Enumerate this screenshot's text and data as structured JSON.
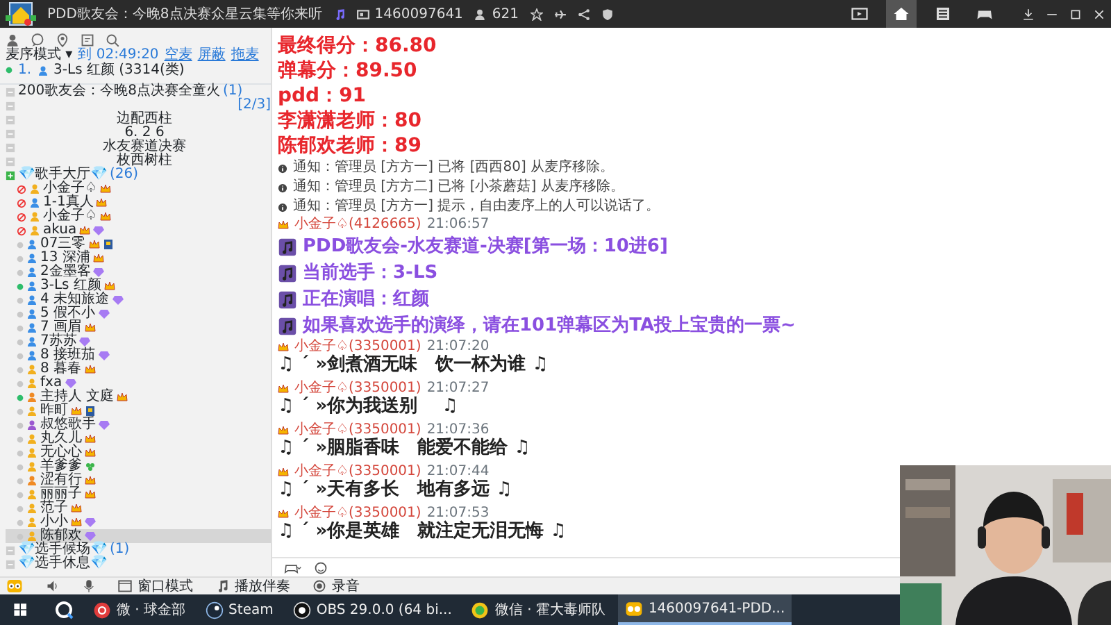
{
  "top_bar": {
    "title": "PDD歌友会：今晚8点决赛众星云集等你来听",
    "channel_id": "1460097641",
    "online_count": "621",
    "nav_tabs": [
      {
        "kind": "video",
        "selected": false
      },
      {
        "kind": "home",
        "selected": true
      },
      {
        "kind": "list",
        "selected": false
      },
      {
        "kind": "game",
        "selected": false
      }
    ]
  },
  "sidebar": {
    "mode": "麦序模式 ▾",
    "timer": "到 02:49:20",
    "actions": [
      "空麦",
      "屏蔽",
      "拖麦"
    ],
    "queue": [
      {
        "index": "1.",
        "name": "3-Ls 红颜 (3314(类)",
        "on_mic": true
      }
    ],
    "tree": [
      {
        "kind": "channel",
        "text": "200歌友会：今晚8点决赛全童火",
        "count": "(1)",
        "expanded": false
      },
      {
        "kind": "channel",
        "count": "[2/3]",
        "expanded": false
      },
      {
        "kind": "banner",
        "text": "边配西柱",
        "expanded": false
      },
      {
        "kind": "banner",
        "text": "6. 2 6",
        "expanded": false
      },
      {
        "kind": "banner",
        "text": "水友赛道决赛",
        "expanded": false
      },
      {
        "kind": "banner",
        "text": "枚西树柱",
        "expanded": false
      },
      {
        "kind": "channel",
        "text": "💎歌手大厅💎",
        "count": "(26)",
        "expanded": true,
        "children": [
          {
            "name": "小金子♤",
            "muted": true,
            "speaking": false,
            "color": "#f2b01e",
            "badges": [
              {
                "kind": "crown"
              }
            ],
            "selected": false
          },
          {
            "name": "1-1真人",
            "muted": true,
            "speaking": false,
            "color": "#3a8ee6",
            "badges": [
              {
                "kind": "crown"
              }
            ],
            "selected": false
          },
          {
            "name": "小金子♤",
            "muted": true,
            "speaking": false,
            "color": "#f2b01e",
            "badges": [
              {
                "kind": "crown"
              }
            ],
            "selected": false
          },
          {
            "name": "akua",
            "muted": true,
            "speaking": false,
            "color": "#f2b01e",
            "badges": [
              {
                "kind": "crown"
              },
              {
                "kind": "gem"
              }
            ],
            "selected": false
          },
          {
            "name": "07三零",
            "muted": false,
            "speaking": false,
            "color": "#3a8ee6",
            "badges": [
              {
                "kind": "crown"
              },
              {
                "kind": "card"
              }
            ],
            "selected": false
          },
          {
            "name": "13 深浦",
            "muted": false,
            "speaking": false,
            "color": "#3a8ee6",
            "badges": [
              {
                "kind": "crown"
              }
            ],
            "selected": false
          },
          {
            "name": "2金墨客",
            "muted": false,
            "speaking": false,
            "color": "#3a8ee6",
            "badges": [
              {
                "kind": "gem"
              }
            ],
            "selected": false
          },
          {
            "name": "3-Ls 红颜",
            "muted": false,
            "speaking": true,
            "color": "#3a8ee6",
            "badges": [
              {
                "kind": "crown"
              }
            ],
            "selected": false
          },
          {
            "name": "4 未知旅途",
            "muted": false,
            "speaking": false,
            "color": "#3a8ee6",
            "badges": [
              {
                "kind": "gem"
              }
            ],
            "selected": false
          },
          {
            "name": "5 假不小",
            "muted": false,
            "speaking": false,
            "color": "#3a8ee6",
            "badges": [
              {
                "kind": "gem"
              }
            ],
            "selected": false
          },
          {
            "name": "7 画眉",
            "muted": false,
            "speaking": false,
            "color": "#3a8ee6",
            "badges": [
              {
                "kind": "crown"
              }
            ],
            "selected": false
          },
          {
            "name": "7苏苏",
            "muted": false,
            "speaking": false,
            "color": "#3a8ee6",
            "badges": [
              {
                "kind": "gem"
              }
            ],
            "selected": false
          },
          {
            "name": "8 接班茄",
            "muted": false,
            "speaking": false,
            "color": "#3a8ee6",
            "badges": [
              {
                "kind": "gem"
              }
            ],
            "selected": false
          },
          {
            "name": "8 暮春",
            "muted": false,
            "speaking": false,
            "color": "#f2b01e",
            "badges": [
              {
                "kind": "crown"
              }
            ],
            "selected": false
          },
          {
            "name": "fxa",
            "muted": false,
            "speaking": false,
            "color": "#f2b01e",
            "badges": [
              {
                "kind": "gem"
              }
            ],
            "selected": false
          },
          {
            "name": "主持人 文庭",
            "muted": false,
            "speaking": true,
            "color": "#f08a24",
            "badges": [
              {
                "kind": "crown"
              }
            ],
            "selected": false
          },
          {
            "name": "昨町",
            "muted": false,
            "speaking": false,
            "color": "#f2b01e",
            "badges": [
              {
                "kind": "crown"
              },
              {
                "kind": "card"
              }
            ],
            "selected": false
          },
          {
            "name": "叔悠歌手",
            "muted": false,
            "speaking": false,
            "color": "#9b59d0",
            "badges": [
              {
                "kind": "gem"
              }
            ],
            "selected": false
          },
          {
            "name": "丸久儿",
            "muted": false,
            "speaking": false,
            "color": "#f2b01e",
            "badges": [
              {
                "kind": "crown"
              }
            ],
            "selected": false
          },
          {
            "name": "无心心",
            "muted": false,
            "speaking": false,
            "color": "#f2b01e",
            "badges": [
              {
                "kind": "crown"
              }
            ],
            "selected": false
          },
          {
            "name": "羊爹爹",
            "muted": false,
            "speaking": false,
            "color": "#f2b01e",
            "badges": [
              {
                "kind": "clover"
              }
            ],
            "selected": false
          },
          {
            "name": "涩有行",
            "muted": false,
            "speaking": false,
            "color": "#f08a24",
            "badges": [
              {
                "kind": "crown"
              }
            ],
            "selected": false
          },
          {
            "name": "丽丽子",
            "muted": false,
            "speaking": false,
            "color": "#f2b01e",
            "badges": [
              {
                "kind": "crown"
              }
            ],
            "selected": false
          },
          {
            "name": "范子",
            "muted": false,
            "speaking": false,
            "color": "#f2b01e",
            "badges": [
              {
                "kind": "crown"
              }
            ],
            "selected": false
          },
          {
            "name": "小小",
            "muted": false,
            "speaking": false,
            "color": "#f2b01e",
            "badges": [
              {
                "kind": "crown"
              },
              {
                "kind": "gem"
              }
            ],
            "selected": false
          },
          {
            "name": "陈郁欢",
            "muted": false,
            "speaking": false,
            "color": "#f2b01e",
            "badges": [
              {
                "kind": "gem"
              }
            ],
            "selected": true
          }
        ]
      },
      {
        "kind": "channel",
        "text": "💎选手候场💎",
        "count": "(1)",
        "expanded": false
      },
      {
        "kind": "channel",
        "text": "💎选手休息💎",
        "expanded": false
      }
    ]
  },
  "chat": {
    "messages": [
      {
        "kind": "score",
        "text": "最终得分：86.80"
      },
      {
        "kind": "score",
        "text": "弹幕分：89.50"
      },
      {
        "kind": "score",
        "text": "pdd：91"
      },
      {
        "kind": "score",
        "text": "李潇潇老师：80"
      },
      {
        "kind": "score",
        "text": "陈郁欢老师：89"
      },
      {
        "kind": "notice",
        "text": "通知：管理员 [方方一] 已将 [西西80] 从麦序移除。"
      },
      {
        "kind": "notice",
        "text": "通知：管理员 [方方二] 已将 [小茶蘑菇] 从麦序移除。"
      },
      {
        "kind": "notice",
        "text": "通知：管理员 [方方一] 提示，自由麦序上的人可以说话了。"
      },
      {
        "kind": "sender",
        "name": "小金子♤(4126665)",
        "time": "21:06:57"
      },
      {
        "kind": "announce",
        "text": "PDD歌友会-水友赛道-决赛[第一场：10进6]"
      },
      {
        "kind": "announce",
        "text": "当前选手：3-LS"
      },
      {
        "kind": "announce",
        "text": "正在演唱：红颜"
      },
      {
        "kind": "announce",
        "text": "如果喜欢选手的演绎，请在101弹幕区为TA投上宝贵的一票~"
      },
      {
        "kind": "sender",
        "name": "小金子♤(3350001)",
        "time": "21:07:20"
      },
      {
        "kind": "lyric",
        "text": "♫ ˊ »剑煮酒无味　饮一杯为谁 ♫"
      },
      {
        "kind": "sender",
        "name": "小金子♤(3350001)",
        "time": "21:07:27"
      },
      {
        "kind": "lyric",
        "text": "♫ ˊ »你为我送别　 ♫"
      },
      {
        "kind": "sender",
        "name": "小金子♤(3350001)",
        "time": "21:07:36"
      },
      {
        "kind": "lyric",
        "text": "♫ ˊ »胭脂香味　能爱不能给 ♫"
      },
      {
        "kind": "sender",
        "name": "小金子♤(3350001)",
        "time": "21:07:44"
      },
      {
        "kind": "lyric",
        "text": "♫ ˊ »天有多长　地有多远 ♫"
      },
      {
        "kind": "sender",
        "name": "小金子♤(3350001)",
        "time": "21:07:53"
      },
      {
        "kind": "lyric",
        "text": "♫ ˊ »你是英雄　就注定无泪无悔 ♫"
      }
    ]
  },
  "toolbar": {
    "items": [
      {
        "kind": "window",
        "label": "窗口模式"
      },
      {
        "kind": "music",
        "label": "播放伴奏"
      },
      {
        "kind": "record",
        "label": "录音"
      }
    ]
  },
  "taskbar": {
    "apps": [
      {
        "kind": "music",
        "label": "微 · 球金部",
        "selected": false
      },
      {
        "kind": "steam",
        "label": "Steam",
        "selected": false
      },
      {
        "kind": "obs",
        "label": "OBS 29.0.0 (64 bi...",
        "selected": false
      },
      {
        "kind": "chat",
        "label": "微信 · 霍大毒师队",
        "selected": false
      },
      {
        "kind": "yy",
        "label": "1460097641-PDD...",
        "selected": true
      }
    ]
  }
}
